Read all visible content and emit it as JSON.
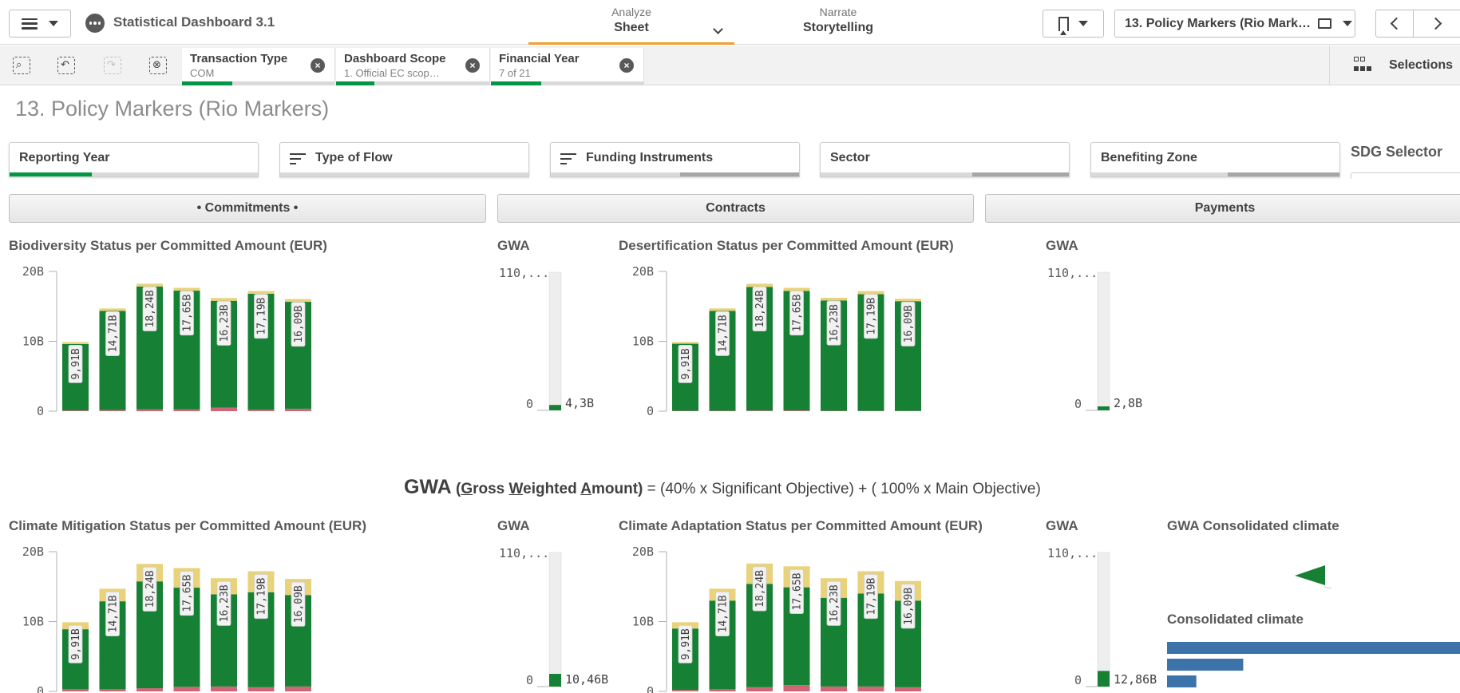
{
  "app": {
    "title": "Statistical Dashboard 3.1"
  },
  "nav": {
    "analyze_label": "Analyze",
    "analyze_value": "Sheet",
    "narrate_label": "Narrate",
    "narrate_value": "Storytelling"
  },
  "sheet_selector": {
    "value": "13. Policy Markers (Rio Markers)"
  },
  "selection_bar": {
    "chips": [
      {
        "title": "Transaction Type",
        "value": "COM",
        "progress": 0.33
      },
      {
        "title": "Dashboard Scope",
        "value": "1. Official EC scope (...",
        "progress": 0.25
      },
      {
        "title": "Financial Year",
        "value": "7 of 21",
        "progress": 0.33
      }
    ],
    "selections_label": "Selections"
  },
  "page": {
    "title": "13. Policy Markers (Rio Markers)"
  },
  "filters": [
    {
      "label": "Reporting Year",
      "has_icon": false,
      "selected": 0.33,
      "excluded": 0.0
    },
    {
      "label": "Type of Flow",
      "has_icon": true,
      "selected": 0.0,
      "excluded": 0.0
    },
    {
      "label": "Funding Instruments",
      "has_icon": true,
      "selected": 0.0,
      "excluded": 0.48
    },
    {
      "label": "Sector",
      "has_icon": false,
      "selected": 0.0,
      "excluded": 0.39
    },
    {
      "label": "Benefiting Zone",
      "has_icon": false,
      "selected": 0.0,
      "excluded": 0.45
    }
  ],
  "sdg_selector": {
    "label": "SDG Selector"
  },
  "toggle_buttons": [
    {
      "label": "• Commitments •",
      "active": true
    },
    {
      "label": "Contracts",
      "active": false
    },
    {
      "label": "Payments",
      "active": false
    }
  ],
  "colors": {
    "green": "#168135",
    "yellow": "#e8d27a",
    "pink": "#cf6678",
    "blue": "#3c73a8",
    "grey_track": "#eeeeee"
  },
  "gwa_formula": {
    "lead": "GWA",
    "open": "(",
    "g": "G",
    "ross": "ross ",
    "w": "W",
    "eighted": "eighted ",
    "a": "A",
    "mount": "mount)",
    "rest": " = (40% x Significant Objective) + ( 100% x Main Objective)"
  },
  "chart_data": [
    {
      "type": "bar",
      "title": "Biodiversity Status per Committed Amount (EUR)",
      "yticks": [
        "20B",
        "10B",
        "0"
      ],
      "ylim": [
        0,
        20
      ],
      "categories": [
        "",
        "",
        "",
        "",
        "",
        "",
        ""
      ],
      "totals_labels": [
        "9,91B",
        "14,71B",
        "18,24B",
        "17,65B",
        "16,23B",
        "17,19B",
        "16,09B"
      ],
      "series": [
        {
          "values": [
            9.5,
            14.2,
            17.6,
            17.0,
            15.3,
            16.6,
            15.3
          ]
        },
        {
          "values": [
            0.3,
            0.35,
            0.4,
            0.4,
            0.4,
            0.4,
            0.4
          ]
        },
        {
          "values": [
            0.1,
            0.15,
            0.25,
            0.25,
            0.5,
            0.2,
            0.35
          ]
        }
      ]
    },
    {
      "type": "bar",
      "title": "GWA",
      "yticks": [
        "110,...",
        "0"
      ],
      "ylim": [
        0,
        110
      ],
      "value_label": "4,3B",
      "values": [
        4.3
      ]
    },
    {
      "type": "bar",
      "title": "Desertification Status per Committed Amount (EUR)",
      "yticks": [
        "20B",
        "10B",
        "0"
      ],
      "ylim": [
        0,
        20
      ],
      "categories": [
        "",
        "",
        "",
        "",
        "",
        "",
        ""
      ],
      "totals_labels": [
        "9,91B",
        "14,71B",
        "18,24B",
        "17,65B",
        "16,23B",
        "17,19B",
        "16,09B"
      ],
      "series": [
        {
          "values": [
            9.6,
            14.3,
            17.7,
            17.1,
            15.8,
            16.7,
            15.7
          ]
        },
        {
          "values": [
            0.25,
            0.35,
            0.45,
            0.45,
            0.38,
            0.45,
            0.35
          ]
        },
        {
          "values": [
            0.05,
            0.06,
            0.09,
            0.1,
            0.05,
            0.04,
            0.04
          ]
        }
      ]
    },
    {
      "type": "bar",
      "title": "GWA",
      "yticks": [
        "110,...",
        "0"
      ],
      "ylim": [
        0,
        110
      ],
      "value_label": "2,8B",
      "values": [
        2.8
      ]
    },
    {
      "type": "bar",
      "title": "Climate Mitigation Status per Committed Amount (EUR)",
      "yticks": [
        "20B",
        "10B",
        "0"
      ],
      "ylim": [
        0,
        20
      ],
      "categories": [
        "",
        "",
        "",
        "",
        "",
        "",
        ""
      ],
      "totals_labels": [
        "9,91B",
        "14,71B",
        "18,24B",
        "17,65B",
        "16,23B",
        "17,19B",
        "16,09B"
      ],
      "series": [
        {
          "values": [
            8.6,
            12.6,
            15.3,
            14.2,
            13.2,
            13.6,
            13.1
          ]
        },
        {
          "values": [
            1.0,
            1.8,
            2.5,
            2.8,
            2.3,
            3.0,
            2.3
          ]
        },
        {
          "values": [
            0.3,
            0.3,
            0.45,
            0.65,
            0.7,
            0.6,
            0.7
          ]
        }
      ]
    },
    {
      "type": "bar",
      "title": "GWA",
      "yticks": [
        "110,...",
        "0"
      ],
      "ylim": [
        0,
        110
      ],
      "value_label": "10,46B",
      "values": [
        10.46
      ]
    },
    {
      "type": "bar",
      "title": "Climate Adaptation Status per Committed Amount (EUR)",
      "yticks": [
        "20B",
        "10B",
        "0"
      ],
      "ylim": [
        0,
        20
      ],
      "categories": [
        "",
        "",
        "",
        "",
        "",
        "",
        ""
      ],
      "totals_labels": [
        "9,91B",
        "14,71B",
        "18,24B",
        "17,65B",
        "16,23B",
        "17,19B",
        "16,09B"
      ],
      "series": [
        {
          "values": [
            8.8,
            12.7,
            14.8,
            14.0,
            12.7,
            13.3,
            12.4
          ]
        },
        {
          "values": [
            0.9,
            1.7,
            2.9,
            3.0,
            2.8,
            3.2,
            2.8
          ]
        },
        {
          "values": [
            0.2,
            0.3,
            0.6,
            0.9,
            0.7,
            0.7,
            0.6
          ]
        }
      ]
    },
    {
      "type": "bar",
      "title": "GWA",
      "yticks": [
        "110,...",
        "0"
      ],
      "ylim": [
        0,
        110
      ],
      "value_label": "12,86B",
      "values": [
        12.86
      ]
    },
    {
      "type": "bar",
      "title": "Consolidated climate",
      "orientation": "horizontal",
      "values": [
        100,
        26,
        10
      ]
    }
  ],
  "gwa_consolidated": {
    "title": "GWA Consolidated climate"
  }
}
